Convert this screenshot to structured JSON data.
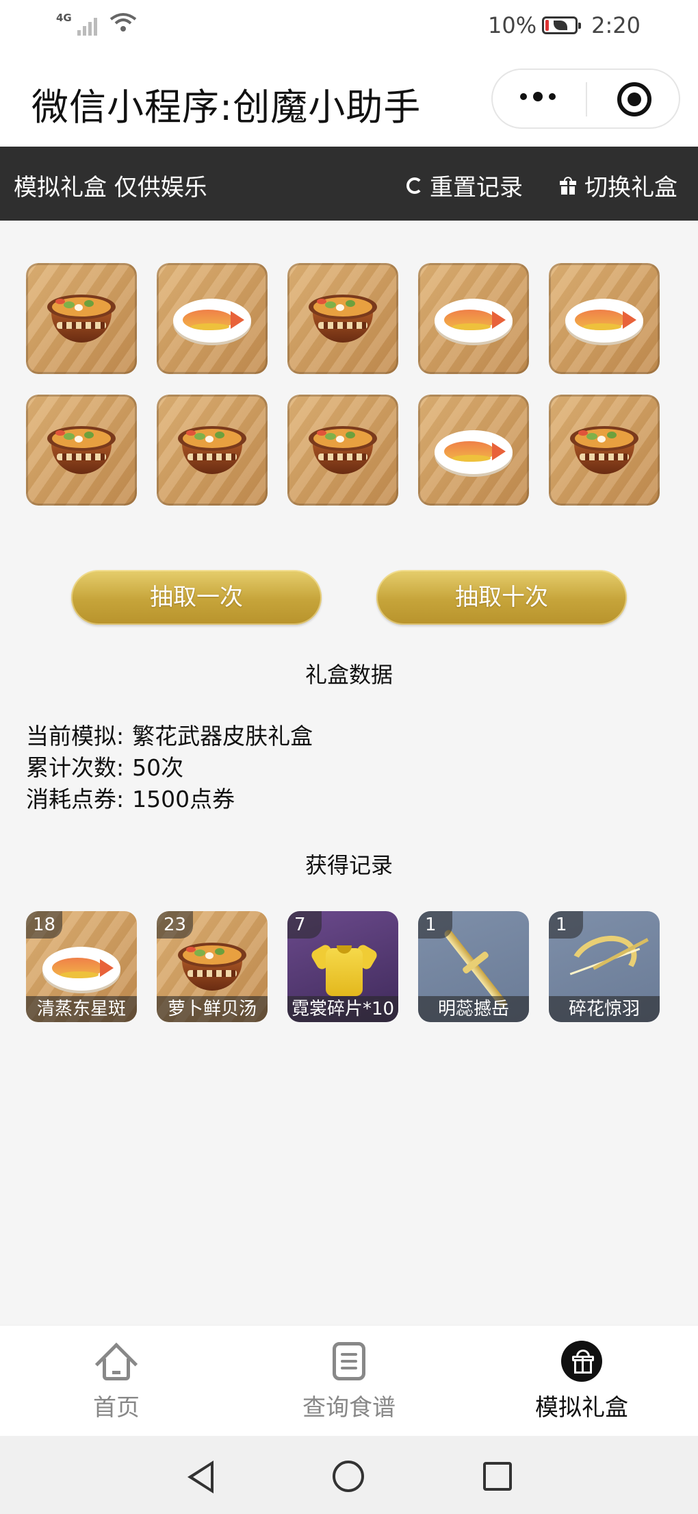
{
  "status_bar": {
    "network": "4G",
    "battery_pct": "10%",
    "time": "2:20"
  },
  "title_bar": {
    "title": "微信小程序:创魔小助手"
  },
  "toolbar": {
    "left_text": "模拟礼盒 仅供娱乐",
    "reset_label": "重置记录",
    "switch_label": "切换礼盒"
  },
  "prize_grid": {
    "items": [
      {
        "kind": "bowl-icon"
      },
      {
        "kind": "fish-plate-icon"
      },
      {
        "kind": "bowl-icon"
      },
      {
        "kind": "fish-plate-icon"
      },
      {
        "kind": "fish-plate-icon"
      },
      {
        "kind": "bowl-icon"
      },
      {
        "kind": "bowl-icon"
      },
      {
        "kind": "bowl-icon"
      },
      {
        "kind": "fish-plate-icon"
      },
      {
        "kind": "bowl-icon"
      }
    ]
  },
  "buttons": {
    "draw_one": "抽取一次",
    "draw_ten": "抽取十次"
  },
  "box_data": {
    "title": "礼盒数据",
    "current_label": "当前模拟:",
    "current_value": "繁花武器皮肤礼盒",
    "total_label": "累计次数:",
    "total_value": "50次",
    "cost_label": "消耗点券:",
    "cost_value": "1500点券"
  },
  "records": {
    "title": "获得记录",
    "items": [
      {
        "count": "18",
        "name": "清蒸东星斑",
        "icon": "fish-plate-icon"
      },
      {
        "count": "23",
        "name": "萝卜鲜贝汤",
        "icon": "bowl-icon"
      },
      {
        "count": "7",
        "name": "霓裳碎片*10",
        "icon": "shirt-icon"
      },
      {
        "count": "1",
        "name": "明蕊撼岳",
        "icon": "sword-icon"
      },
      {
        "count": "1",
        "name": "碎花惊羽",
        "icon": "bow-icon"
      }
    ]
  },
  "tabbar": {
    "home": "首页",
    "recipe": "查询食谱",
    "gift": "模拟礼盒"
  }
}
